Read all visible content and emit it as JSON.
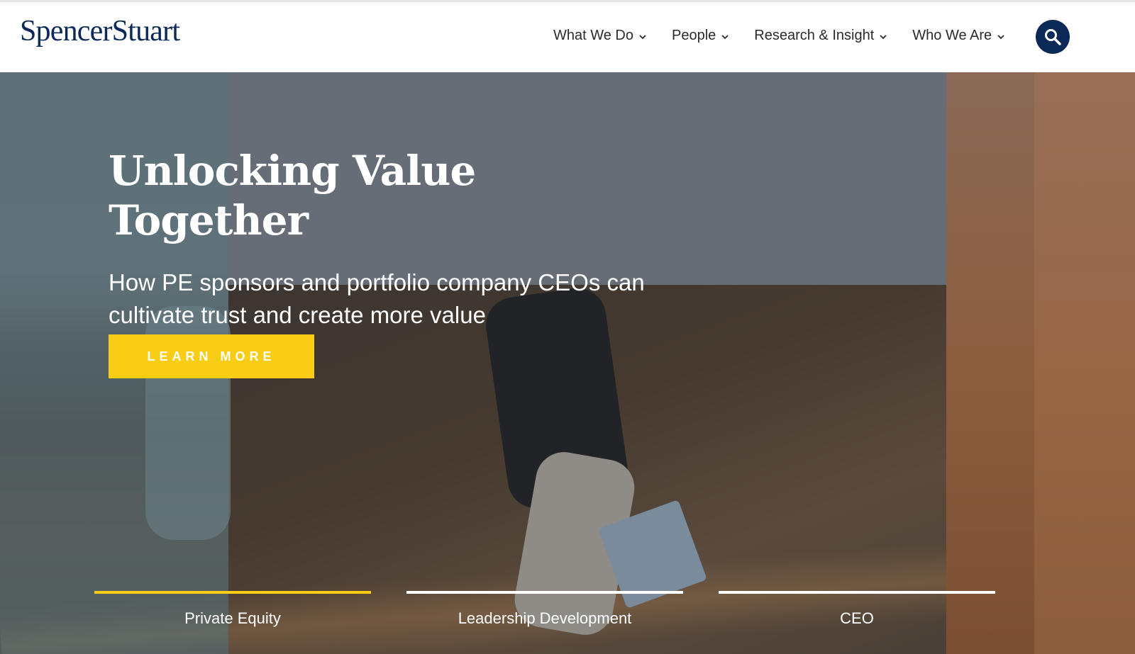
{
  "brand": {
    "logo_text": "SpencerStuart",
    "primary_color": "#0b2a57",
    "accent_color": "#f9cd16"
  },
  "nav": {
    "items": [
      {
        "label": "What We Do",
        "icon": "chevron-down-icon"
      },
      {
        "label": "People",
        "icon": "chevron-down-icon"
      },
      {
        "label": "Research & Insight",
        "icon": "chevron-down-icon"
      },
      {
        "label": "Who We Are",
        "icon": "chevron-down-icon"
      }
    ],
    "search_icon": "search-icon"
  },
  "hero": {
    "title": "Unlocking Value Together",
    "subtitle": "How PE sponsors and portfolio company CEOs can cultivate trust and create more value",
    "cta_label": "LEARN MORE"
  },
  "tabs": [
    {
      "label": "Private Equity",
      "active": true
    },
    {
      "label": "Leadership Development",
      "active": false
    },
    {
      "label": "CEO",
      "active": false
    }
  ]
}
